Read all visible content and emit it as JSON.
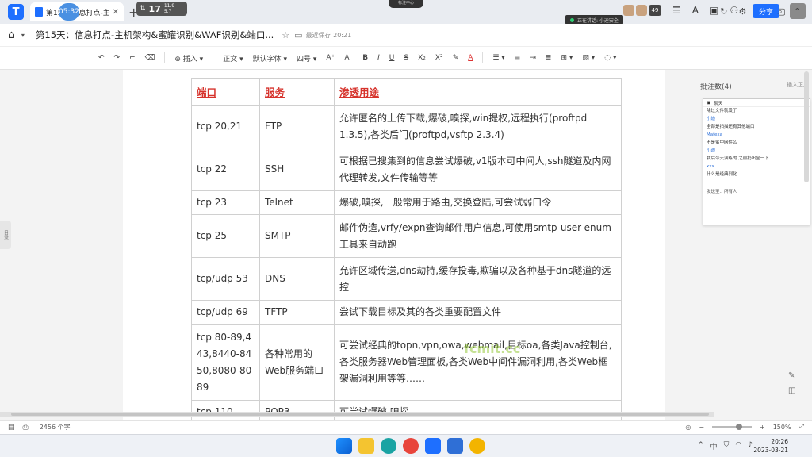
{
  "tabbar": {
    "app_logo": "T",
    "tab_label": "第15天:信息打点-主机",
    "timer": "05:32",
    "net_big": "17",
    "net_up": "11.9",
    "net_down": "5.7",
    "rec_label": "标注中心",
    "speaking_label": "正在讲话: 小迪安全"
  },
  "titlebar": {
    "doc_title": "第15天：信息打点-主机架构&蜜罐识别&WAF识别&端口...",
    "saved_status": "最近保存 20:21",
    "collab_count": "49",
    "share_label": "分享"
  },
  "toolbar": {
    "insert": "插入",
    "style": "正文",
    "font": "默认字体",
    "size": "四号",
    "bold": "B",
    "italic": "I",
    "underline": "U",
    "strike": "S",
    "sub": "X₂",
    "sup": "X²",
    "color": "A"
  },
  "table": {
    "headers": [
      "端口",
      "服务",
      "渗透用途"
    ],
    "rows": [
      [
        "tcp 20,21",
        "FTP",
        "允许匿名的上传下载,爆破,嗅探,win提权,远程执行(proftpd 1.3.5),各类后门(proftpd,vsftp 2.3.4)"
      ],
      [
        "tcp 22",
        "SSH",
        "可根据已搜集到的信息尝试爆破,v1版本可中间人,ssh隧道及内网代理转发,文件传输等等"
      ],
      [
        "tcp 23",
        "Telnet",
        "爆破,嗅探,一般常用于路由,交换登陆,可尝试弱口令"
      ],
      [
        "tcp 25",
        "SMTP",
        "邮件伪造,vrfy/expn查询邮件用户信息,可使用smtp-user-enum工具来自动跑"
      ],
      [
        "tcp/udp 53",
        "DNS",
        "允许区域传送,dns劫持,缓存投毒,欺骗以及各种基于dns隧道的远控"
      ],
      [
        "tcp/udp 69",
        "TFTP",
        "尝试下载目标及其的各类重要配置文件"
      ],
      [
        "tcp 80-89,443,8440-8450,8080-8089",
        "各种常用的Web服务端口",
        "可尝试经典的topn,vpn,owa,webmail,目标oa,各类Java控制台,各类服务器Web管理面板,各类Web中间件漏洞利用,各类Web框架漏洞利用等等……"
      ],
      [
        "tcp 110",
        "POP3",
        "可尝试爆破,嗅探"
      ]
    ]
  },
  "watermark": "fcmit.cc",
  "left_handle": "目录",
  "side_panel": {
    "title": "批注数(4)",
    "insert_label": "插入正文",
    "chat_title": "聊天",
    "messages": [
      {
        "text": "除过文件就没了",
        "blue": false
      },
      {
        "text": "小迪",
        "blue": true
      },
      {
        "text": "全部是扫描还有其他端口",
        "blue": false
      },
      {
        "text": "Mafexa",
        "blue": true
      },
      {
        "text": "不是蜜中网件么",
        "blue": false
      },
      {
        "text": "小迪",
        "blue": true
      },
      {
        "text": "我后今天演练的 之前扔出全一下",
        "blue": false
      },
      {
        "text": "xxx",
        "blue": true
      },
      {
        "text": "什么是经典列化",
        "blue": false
      }
    ],
    "chat_foot": "发送至：所有人"
  },
  "statusbar": {
    "word_count": "2456 个字",
    "zoom": "150%"
  },
  "taskbar": {
    "time": "20:26",
    "date": "2023-03-21",
    "lang": "中"
  }
}
